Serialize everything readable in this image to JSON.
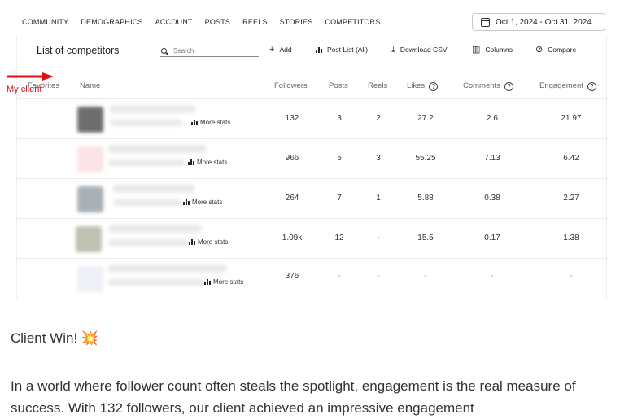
{
  "nav": {
    "items": [
      "COMMUNITY",
      "DEMOGRAPHICS",
      "ACCOUNT",
      "POSTS",
      "REELS",
      "STORIES",
      "COMPETITORS"
    ],
    "date_range": "Oct 1, 2024 - Oct 31, 2024"
  },
  "panel": {
    "title": "List of competitors",
    "search_placeholder": "Search",
    "tools": {
      "add": "Add",
      "post_list": "Post List (All)",
      "download": "Download CSV",
      "columns": "Columns",
      "compare": "Compare"
    }
  },
  "table": {
    "headers": {
      "favorites": "Favorites",
      "name": "Name",
      "followers": "Followers",
      "posts": "Posts",
      "reels": "Reels",
      "likes": "Likes",
      "comments": "Comments",
      "engagement": "Engagement"
    },
    "more_stats_label": "More stats",
    "rows": [
      {
        "followers": "132",
        "posts": "3",
        "reels": "2",
        "likes": "27.2",
        "comments": "2.6",
        "engagement": "21.97"
      },
      {
        "followers": "966",
        "posts": "5",
        "reels": "3",
        "likes": "55.25",
        "comments": "7.13",
        "engagement": "6.42"
      },
      {
        "followers": "264",
        "posts": "7",
        "reels": "1",
        "likes": "5.88",
        "comments": "0.38",
        "engagement": "2.27"
      },
      {
        "followers": "1.09k",
        "posts": "12",
        "reels": "-",
        "likes": "15.5",
        "comments": "0.17",
        "engagement": "1.38"
      },
      {
        "followers": "376",
        "posts": "-",
        "reels": "-",
        "likes": "-",
        "comments": "-",
        "engagement": "-"
      }
    ]
  },
  "annotation": {
    "label": "My client",
    "color": "#dd1111"
  },
  "post": {
    "headline": "Client Win! 💥",
    "paragraph": "In a world where follower count often steals the spotlight, engagement is the real measure of success. With 132 followers, our client achieved an impressive engagement"
  }
}
